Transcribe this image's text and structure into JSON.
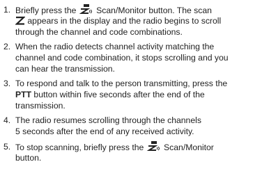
{
  "steps": [
    {
      "number": "1.",
      "lines": [
        {
          "pre": "Briefly press the",
          "icon": "scan-monitor-icon",
          "post": "Scan/Monitor button. The scan"
        },
        {
          "icon": "scan-z-icon",
          "post": "appears in the display and the radio begins to scroll"
        },
        {
          "text": "through the channel and code combinations."
        }
      ]
    },
    {
      "number": "2.",
      "lines": [
        {
          "text": "When the radio detects channel activity matching the"
        },
        {
          "text": "channel and code combination, it stops scrolling and you"
        },
        {
          "text": "can hear the transmission."
        }
      ]
    },
    {
      "number": "3.",
      "lines": [
        {
          "text": "To respond and talk to the person transmitting, press the"
        },
        {
          "bold": "PTT",
          "post": "button within five seconds after the end of the"
        },
        {
          "text": "transmission."
        }
      ]
    },
    {
      "number": "4.",
      "lines": [
        {
          "text": "The radio resumes scrolling through the channels"
        },
        {
          "text": "5 seconds after the end of any received activity."
        }
      ]
    },
    {
      "number": "5.",
      "lines": [
        {
          "pre": "To stop scanning, briefly press the",
          "icon": "scan-monitor-icon",
          "post": "Scan/Monitor"
        },
        {
          "text": "button."
        }
      ]
    }
  ]
}
